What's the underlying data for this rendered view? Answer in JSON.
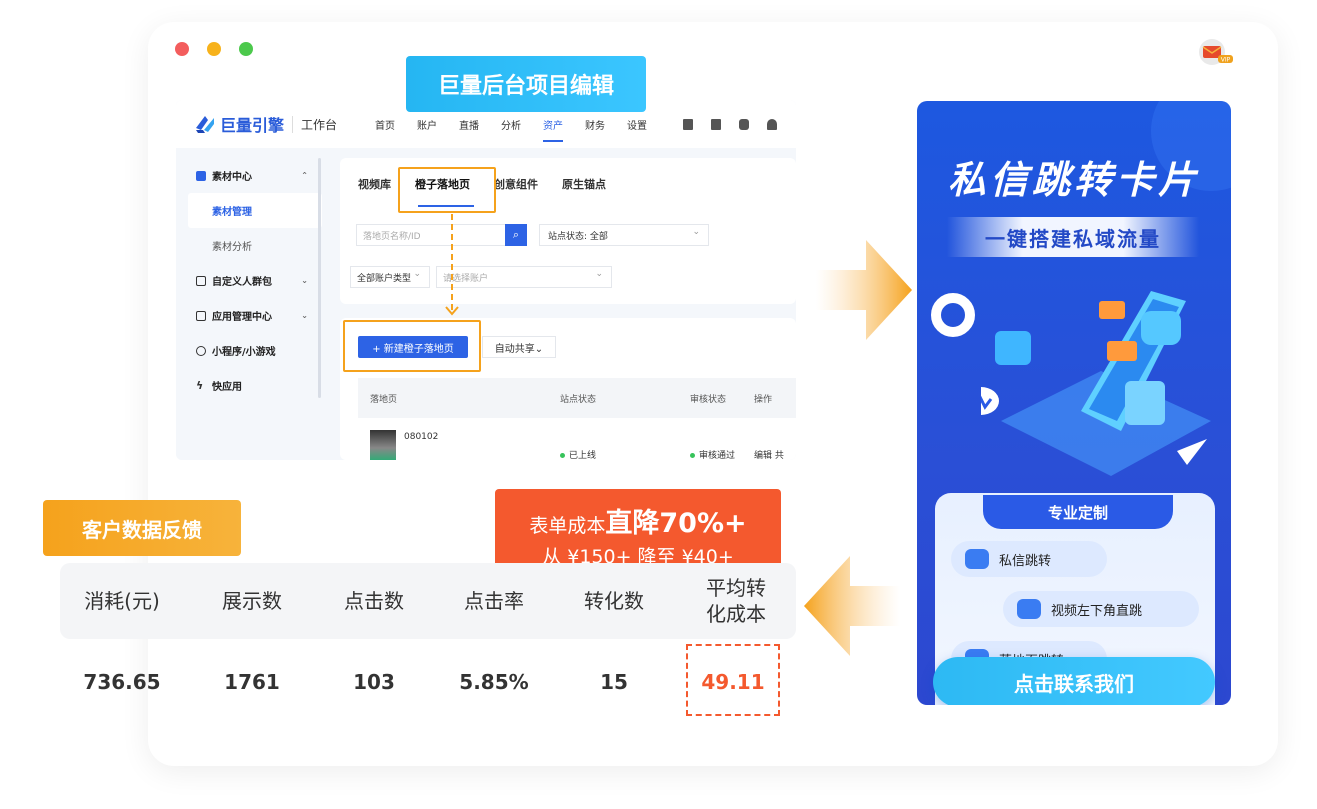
{
  "banner_top": "巨量后台项目编辑",
  "app": {
    "brand": "巨量引擎",
    "workspace": "工作台",
    "nav": [
      "首页",
      "账户",
      "直播",
      "分析",
      "资产",
      "财务",
      "设置"
    ],
    "nav_active_index": 4
  },
  "sidebar": {
    "items": [
      {
        "label": "素材中心",
        "icon": "video-icon",
        "chevron": "⌃"
      },
      {
        "label": "素材管理",
        "active": true
      },
      {
        "label": "素材分析"
      },
      {
        "label": "自定义人群包",
        "icon": "audience-icon",
        "chevron": "⌄"
      },
      {
        "label": "应用管理中心",
        "icon": "app-icon",
        "chevron": "⌄"
      },
      {
        "label": "小程序/小游戏",
        "icon": "miniprogram-icon"
      },
      {
        "label": "快应用",
        "icon": "quickapp-icon"
      }
    ]
  },
  "tabs": [
    "视频库",
    "橙子落地页",
    "创意组件",
    "原生锚点"
  ],
  "filters": {
    "search_placeholder": "落地页名称/ID",
    "status_label": "站点状态:",
    "status_value": "全部",
    "account_type": "全部账户类型",
    "account_placeholder": "请选择账户"
  },
  "actions": {
    "new_button": "+ 新建橙子落地页",
    "share_button": "自动共享⌄"
  },
  "table": {
    "headers": [
      "落地页",
      "站点状态",
      "审核状态",
      "操作"
    ],
    "row": {
      "id": "080102",
      "status": "已上线",
      "review": "审核通过",
      "ops": "编辑  共"
    }
  },
  "phone": {
    "title": "私信跳转卡片",
    "subtitle": "一键搭建私域流量",
    "panel_title": "专业定制",
    "options": [
      "私信跳转",
      "视频左下角直跳",
      "落地页跳转"
    ],
    "cta": "点击联系我们"
  },
  "feedback_label": "客户数据反馈",
  "promo": {
    "prefix": "表单成本",
    "highlight": "直降70%+",
    "line2": "从 ¥150+ 降至 ¥40+"
  },
  "stats": {
    "headers": [
      "消耗(元)",
      "展示数",
      "点击数",
      "点击率",
      "转化数",
      "平均转\n化成本"
    ],
    "values": [
      "736.65",
      "1761",
      "103",
      "5.85%",
      "15",
      "49.11"
    ]
  },
  "colors": {
    "primary": "#2d63e5",
    "orange": "#f5a21c",
    "red": "#f4592e",
    "cyan": "#25b6f2"
  }
}
